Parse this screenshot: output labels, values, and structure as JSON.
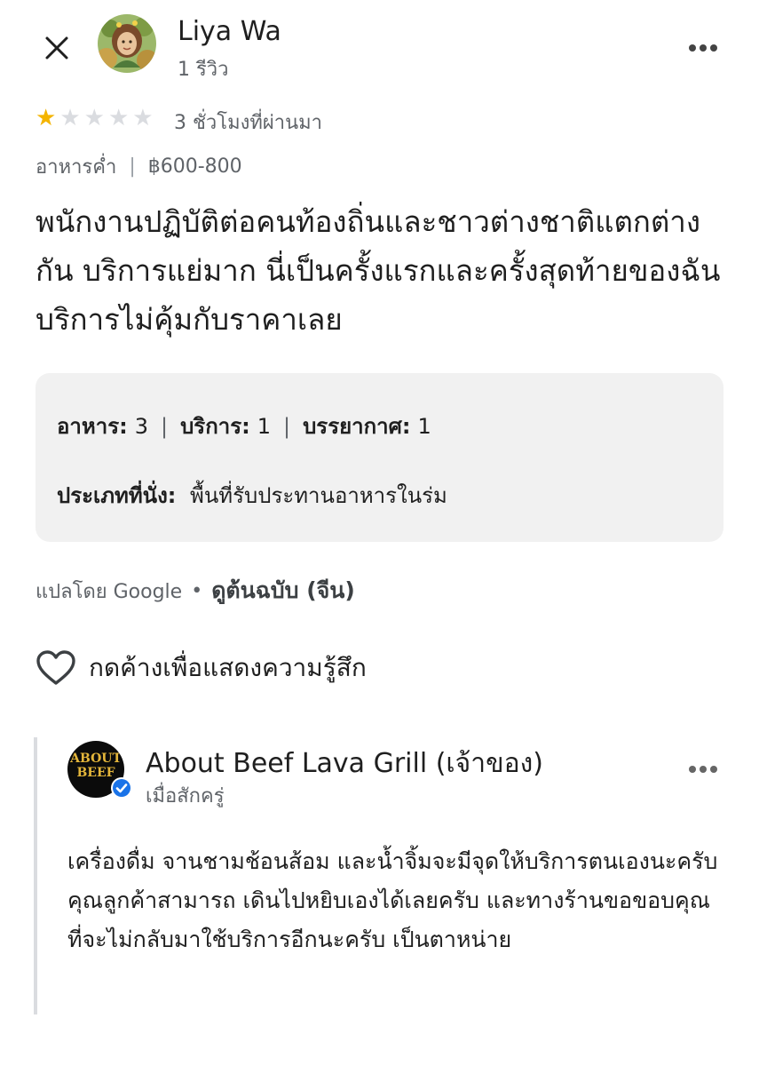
{
  "header": {
    "reviewer_name": "Liya Wa",
    "review_count": "1 รีวิว",
    "close_icon": "close-icon",
    "more_icon": "more-horiz-icon"
  },
  "review": {
    "rating": 1,
    "max_rating": 5,
    "time_ago": "3 ชั่วโมงที่ผ่านมา",
    "meal": "อาหารค่ำ",
    "price": "฿600-800",
    "text": "พนักงานปฏิบัติต่อคนท้องถิ่นและชาวต่างชาติแตกต่างกัน บริการแย่มาก นี่เป็นครั้งแรกและครั้งสุดท้ายของฉัน บริการไม่คุ้มกับราคาเลย"
  },
  "ratings": {
    "food_label": "อาหาร:",
    "food_value": "3",
    "service_label": "บริการ:",
    "service_value": "1",
    "atmosphere_label": "บรรยากาศ:",
    "atmosphere_value": "1",
    "seating_label": "ประเภทที่นั่ง:",
    "seating_value": "พื้นที่รับประทานอาหารในร่ม"
  },
  "translation": {
    "translated_by": "แปลโดย Google",
    "separator": "•",
    "see_original": "ดูต้นฉบับ (จีน)"
  },
  "reaction": {
    "label": "กดค้างเพื่อแสดงความรู้สึก",
    "icon": "heart-outline-icon"
  },
  "owner_reply": {
    "name": "About Beef Lava Grill (เจ้าของ)",
    "time": "เมื่อสักครู่",
    "logo_line1": "ABOUT",
    "logo_line2": "BEEF",
    "verified_icon": "verified-check-icon",
    "text": "เครื่องดื่ม จานชามช้อนส้อม และน้ำจิ้มจะมีจุดให้บริการตนเองนะครับ คุณลูกค้าสามารถ เดินไปหยิบเองได้เลยครับ และทางร้านขอขอบคุณที่จะไม่กลับมาใช้บริการอีกนะครับ เป็นตาหน่าย"
  },
  "colors": {
    "star_on": "#f4b400",
    "star_off": "#dadce0",
    "secondary_text": "#5f6368",
    "verified_blue": "#1a73e8",
    "box_bg": "#f1f1f1"
  }
}
